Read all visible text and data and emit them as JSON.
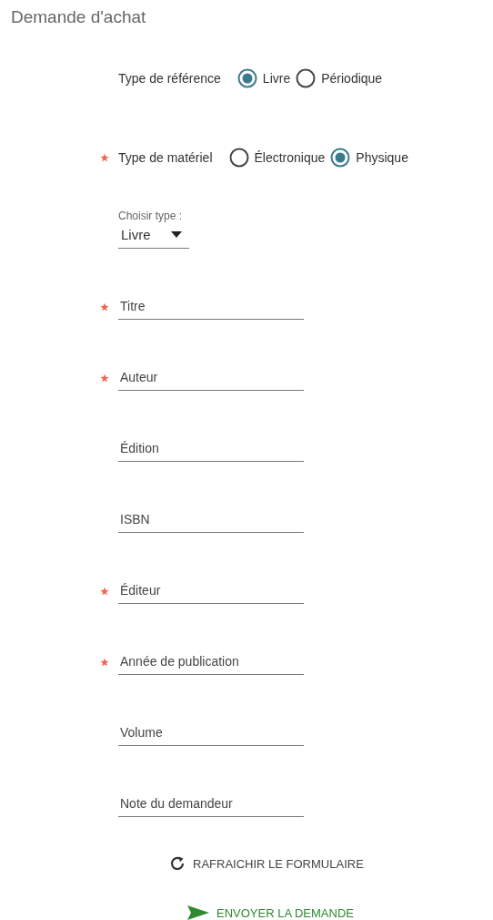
{
  "title": "Demande d'achat",
  "radio_groups": [
    {
      "label": "Type de référence",
      "required": false,
      "options": [
        {
          "label": "Livre",
          "selected": true
        },
        {
          "label": "Périodique",
          "selected": false
        }
      ]
    },
    {
      "label": "Type de matériel",
      "required": true,
      "options": [
        {
          "label": "Électronique",
          "selected": false
        },
        {
          "label": "Physique",
          "selected": true
        }
      ]
    }
  ],
  "select": {
    "label": "Choisir type :",
    "value": "Livre"
  },
  "fields": [
    {
      "placeholder": "Titre",
      "required": true
    },
    {
      "placeholder": "Auteur",
      "required": true
    },
    {
      "placeholder": "Édition",
      "required": false
    },
    {
      "placeholder": "ISBN",
      "required": false
    },
    {
      "placeholder": "Éditeur",
      "required": true
    },
    {
      "placeholder": "Année de publication",
      "required": true
    },
    {
      "placeholder": "Volume",
      "required": false
    },
    {
      "placeholder": "Note du demandeur",
      "required": false
    }
  ],
  "buttons": [
    {
      "kind": "refresh",
      "label": "RAFRAICHIR LE FORMULAIRE"
    },
    {
      "kind": "send",
      "label": "ENVOYER LA DEMANDE"
    }
  ]
}
